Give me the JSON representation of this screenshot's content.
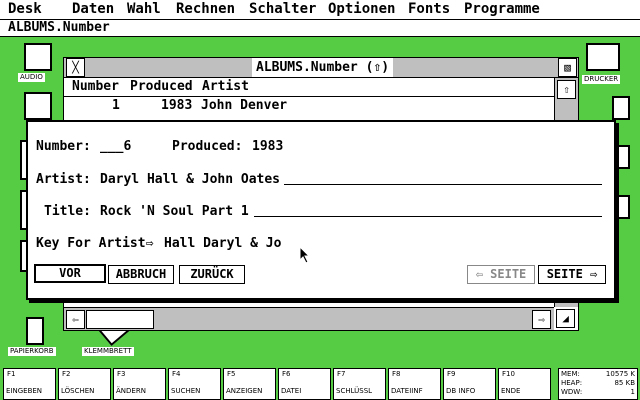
{
  "menu": [
    "Desk",
    "Daten",
    "Wahl",
    "Rechnen",
    "Schalter",
    "Optionen",
    "Fonts",
    "Programme"
  ],
  "app_title": "ALBUMS.Number",
  "desktop_icons": {
    "audio": "AUDIO",
    "drucker": "DRUCKER",
    "papierkorb": "PAPIERKORB",
    "klemmbrett": "KLEMMBRETT"
  },
  "window": {
    "title": "ALBUMS.Number (⇧)",
    "close_glyph": "╳",
    "full_glyph": "▧",
    "columns": [
      "Number",
      "Produced",
      "Artist"
    ],
    "rows": [
      {
        "number": "1",
        "produced": "1983",
        "artist": "John Denver"
      }
    ],
    "scroll_up": "⇧",
    "scroll_left": "⇦",
    "scroll_right": "⇨",
    "resize_glyph": "◢"
  },
  "dialog": {
    "number_label": "Number:",
    "number_value": "___6",
    "produced_label": "Produced:",
    "produced_value": "1983",
    "artist_label": "Artist:",
    "artist_value": "Daryl Hall & John Oates",
    "title_label": "Title:",
    "title_value": "Rock 'N Soul Part 1",
    "key_label": "Key For Artist⇨",
    "key_value": "Hall Daryl & Jo",
    "buttons": {
      "vor": "VOR",
      "abbruch": "ABBRUCH",
      "zurueck": "ZURÜCK",
      "seite_back": "⇦ SEITE",
      "seite_fwd": "SEITE ⇨"
    }
  },
  "function_keys": [
    {
      "key": "F1",
      "label": "EINGEBEN"
    },
    {
      "key": "F2",
      "label": "LÖSCHEN"
    },
    {
      "key": "F3",
      "label": "ÄNDERN"
    },
    {
      "key": "F4",
      "label": "SUCHEN"
    },
    {
      "key": "F5",
      "label": "ANZEIGEN"
    },
    {
      "key": "F6",
      "label": "DATEI"
    },
    {
      "key": "F7",
      "label": "SCHLÜSSL"
    },
    {
      "key": "F8",
      "label": "DATEIINF"
    },
    {
      "key": "F9",
      "label": "DB INFO"
    },
    {
      "key": "F10",
      "label": "ENDE"
    }
  ],
  "memory": [
    {
      "label": "MEM:",
      "value": "10575 K"
    },
    {
      "label": "HEAP:",
      "value": "85 KB"
    },
    {
      "label": "WDW:",
      "value": "1"
    }
  ],
  "colors": {
    "desktop": "#55cc44",
    "bar": "#bfbfbf",
    "disabled": "#888888"
  }
}
